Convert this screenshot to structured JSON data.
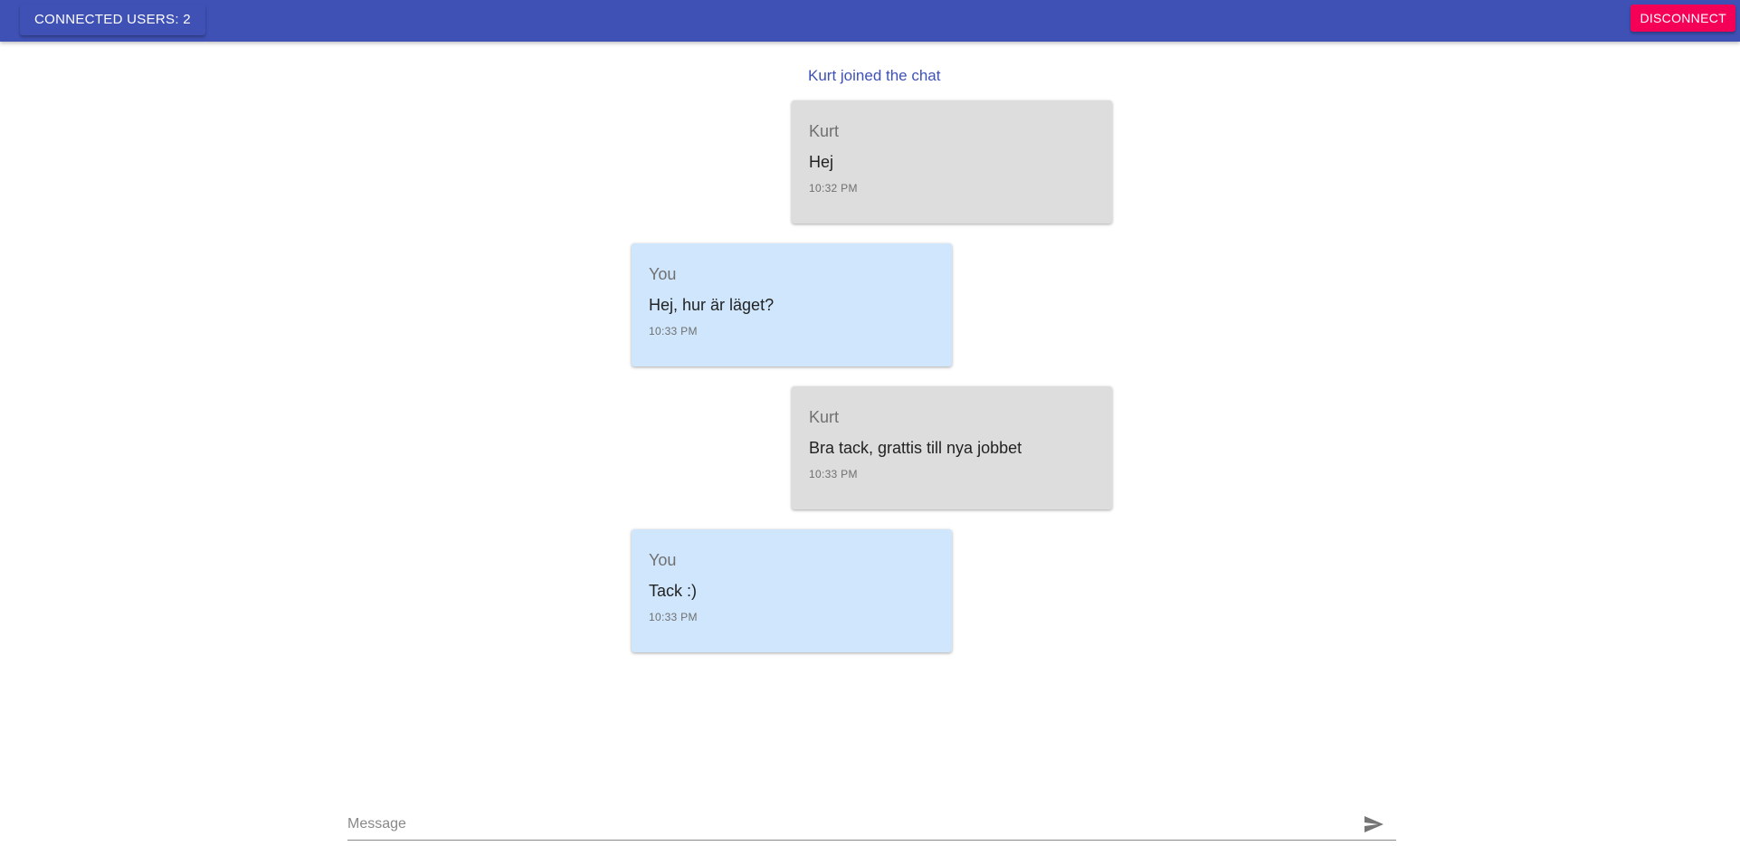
{
  "header": {
    "connected_users_label": "CONNECTED USERS: 2",
    "disconnect_label": "DISCONNECT"
  },
  "chat": {
    "system_message": "Kurt joined the chat",
    "messages": [
      {
        "sender": "Kurt",
        "text": "Hej",
        "time": "10:32 PM",
        "from": "other"
      },
      {
        "sender": "You",
        "text": "Hej, hur är läget?",
        "time": "10:33 PM",
        "from": "self"
      },
      {
        "sender": "Kurt",
        "text": "Bra tack, grattis till nya jobbet",
        "time": "10:33 PM",
        "from": "other"
      },
      {
        "sender": "You",
        "text": "Tack :)",
        "time": "10:33 PM",
        "from": "self"
      }
    ]
  },
  "composer": {
    "placeholder": "Message",
    "value": "",
    "send_icon": "send-icon"
  },
  "colors": {
    "appbar": "#3f51b5",
    "accent": "#f50057",
    "other_bubble": "#dddddd",
    "self_bubble": "#cfe6fc"
  }
}
